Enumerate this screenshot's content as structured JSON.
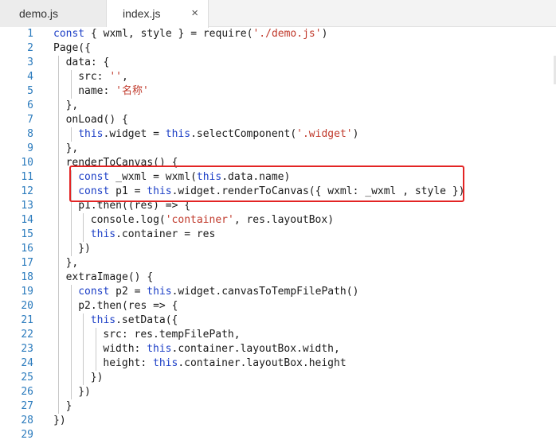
{
  "tabs": [
    {
      "label": "demo.js"
    },
    {
      "label": "index.js",
      "close": "×"
    }
  ],
  "highlight_color": "#e32424",
  "code_lines": [
    {
      "n": "1",
      "indent": 0,
      "parts": [
        {
          "t": "k",
          "v": "const"
        },
        {
          "t": "p",
          "v": " { wxml, style } = require("
        },
        {
          "t": "s",
          "v": "'./demo.js'"
        },
        {
          "t": "p",
          "v": ")"
        }
      ]
    },
    {
      "n": "2",
      "indent": 0,
      "parts": [
        {
          "t": "p",
          "v": "Page({"
        }
      ]
    },
    {
      "n": "3",
      "indent": 1,
      "parts": [
        {
          "t": "p",
          "v": "data: {"
        }
      ]
    },
    {
      "n": "4",
      "indent": 2,
      "parts": [
        {
          "t": "p",
          "v": "src: "
        },
        {
          "t": "s",
          "v": "''"
        },
        {
          "t": "p",
          "v": ","
        }
      ]
    },
    {
      "n": "5",
      "indent": 2,
      "parts": [
        {
          "t": "p",
          "v": "name: "
        },
        {
          "t": "s",
          "v": "'名称'"
        }
      ]
    },
    {
      "n": "6",
      "indent": 1,
      "parts": [
        {
          "t": "p",
          "v": "},"
        }
      ]
    },
    {
      "n": "7",
      "indent": 1,
      "parts": [
        {
          "t": "p",
          "v": "onLoad() {"
        }
      ]
    },
    {
      "n": "8",
      "indent": 2,
      "parts": [
        {
          "t": "k",
          "v": "this"
        },
        {
          "t": "p",
          "v": ".widget = "
        },
        {
          "t": "k",
          "v": "this"
        },
        {
          "t": "p",
          "v": ".selectComponent("
        },
        {
          "t": "s",
          "v": "'.widget'"
        },
        {
          "t": "p",
          "v": ")"
        }
      ]
    },
    {
      "n": "9",
      "indent": 1,
      "parts": [
        {
          "t": "p",
          "v": "},"
        }
      ]
    },
    {
      "n": "10",
      "indent": 1,
      "parts": [
        {
          "t": "p",
          "v": "renderToCanvas() {"
        }
      ]
    },
    {
      "n": "11",
      "indent": 2,
      "parts": [
        {
          "t": "k",
          "v": "const"
        },
        {
          "t": "p",
          "v": " _wxml = wxml("
        },
        {
          "t": "k",
          "v": "this"
        },
        {
          "t": "p",
          "v": ".data.name)"
        }
      ]
    },
    {
      "n": "12",
      "indent": 2,
      "parts": [
        {
          "t": "k",
          "v": "const"
        },
        {
          "t": "p",
          "v": " p1 = "
        },
        {
          "t": "k",
          "v": "this"
        },
        {
          "t": "p",
          "v": ".widget.renderToCanvas({ wxml: _wxml , style })"
        }
      ]
    },
    {
      "n": "13",
      "indent": 2,
      "parts": [
        {
          "t": "p",
          "v": "p1.then((res) => {"
        }
      ]
    },
    {
      "n": "14",
      "indent": 3,
      "parts": [
        {
          "t": "p",
          "v": "console.log("
        },
        {
          "t": "s",
          "v": "'container'"
        },
        {
          "t": "p",
          "v": ", res.layoutBox)"
        }
      ]
    },
    {
      "n": "15",
      "indent": 3,
      "parts": [
        {
          "t": "k",
          "v": "this"
        },
        {
          "t": "p",
          "v": ".container = res"
        }
      ]
    },
    {
      "n": "16",
      "indent": 2,
      "parts": [
        {
          "t": "p",
          "v": "})"
        }
      ]
    },
    {
      "n": "17",
      "indent": 1,
      "parts": [
        {
          "t": "p",
          "v": "},"
        }
      ]
    },
    {
      "n": "18",
      "indent": 1,
      "parts": [
        {
          "t": "p",
          "v": "extraImage() {"
        }
      ]
    },
    {
      "n": "19",
      "indent": 2,
      "parts": [
        {
          "t": "k",
          "v": "const"
        },
        {
          "t": "p",
          "v": " p2 = "
        },
        {
          "t": "k",
          "v": "this"
        },
        {
          "t": "p",
          "v": ".widget.canvasToTempFilePath()"
        }
      ]
    },
    {
      "n": "20",
      "indent": 2,
      "parts": [
        {
          "t": "p",
          "v": "p2.then(res => {"
        }
      ]
    },
    {
      "n": "21",
      "indent": 3,
      "parts": [
        {
          "t": "k",
          "v": "this"
        },
        {
          "t": "p",
          "v": ".setData({"
        }
      ]
    },
    {
      "n": "22",
      "indent": 4,
      "parts": [
        {
          "t": "p",
          "v": "src: res.tempFilePath,"
        }
      ]
    },
    {
      "n": "23",
      "indent": 4,
      "parts": [
        {
          "t": "p",
          "v": "width: "
        },
        {
          "t": "k",
          "v": "this"
        },
        {
          "t": "p",
          "v": ".container.layoutBox.width,"
        }
      ]
    },
    {
      "n": "24",
      "indent": 4,
      "parts": [
        {
          "t": "p",
          "v": "height: "
        },
        {
          "t": "k",
          "v": "this"
        },
        {
          "t": "p",
          "v": ".container.layoutBox.height"
        }
      ]
    },
    {
      "n": "25",
      "indent": 3,
      "parts": [
        {
          "t": "p",
          "v": "})"
        }
      ]
    },
    {
      "n": "26",
      "indent": 2,
      "parts": [
        {
          "t": "p",
          "v": "})"
        }
      ]
    },
    {
      "n": "27",
      "indent": 1,
      "parts": [
        {
          "t": "p",
          "v": "}"
        }
      ]
    },
    {
      "n": "28",
      "indent": 0,
      "parts": [
        {
          "t": "p",
          "v": "})"
        }
      ]
    },
    {
      "n": "29",
      "indent": 0,
      "parts": []
    }
  ]
}
